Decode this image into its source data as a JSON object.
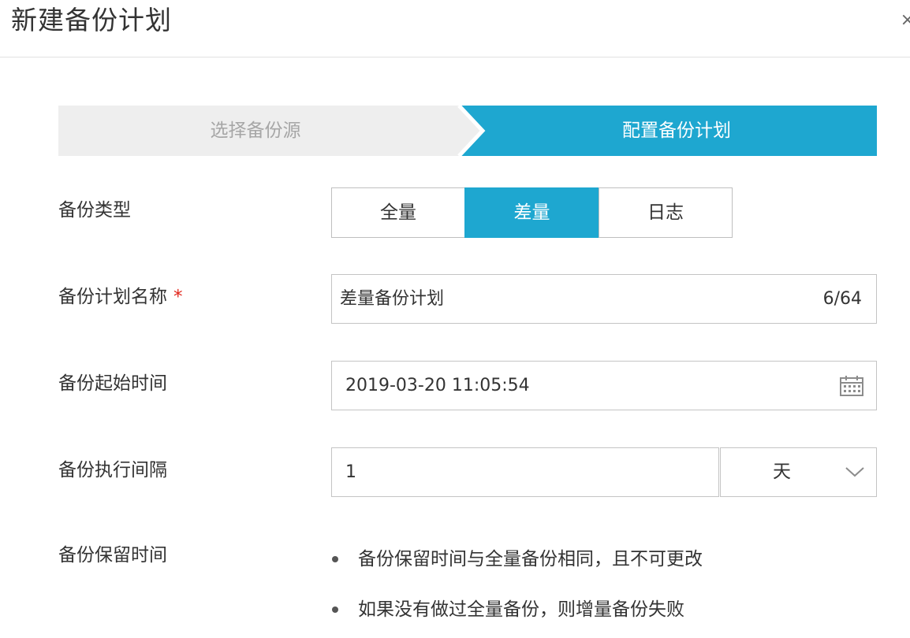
{
  "dialog": {
    "title": "新建备份计划",
    "close_glyph": "×"
  },
  "steps": [
    {
      "label": "选择备份源",
      "state": "inactive"
    },
    {
      "label": "配置备份计划",
      "state": "active"
    }
  ],
  "colors": {
    "accent": "#1ea7d0",
    "inactive_step_bg": "#eeeeee",
    "required": "#e1251b"
  },
  "form": {
    "backup_type": {
      "label": "备份类型",
      "options": [
        "全量",
        "差量",
        "日志"
      ],
      "selected": "差量"
    },
    "plan_name": {
      "label": "备份计划名称",
      "required_mark": "*",
      "value": "差量备份计划",
      "counter": "6/64"
    },
    "start_time": {
      "label": "备份起始时间",
      "value": "2019-03-20 11:05:54",
      "icon": "calendar-icon"
    },
    "interval": {
      "label": "备份执行间隔",
      "value": "1",
      "unit": "天",
      "unit_icon": "chevron-down-icon"
    },
    "retention": {
      "label": "备份保留时间",
      "notes": [
        "备份保留时间与全量备份相同，且不可更改",
        "如果没有做过全量备份，则增量备份失败"
      ]
    }
  }
}
